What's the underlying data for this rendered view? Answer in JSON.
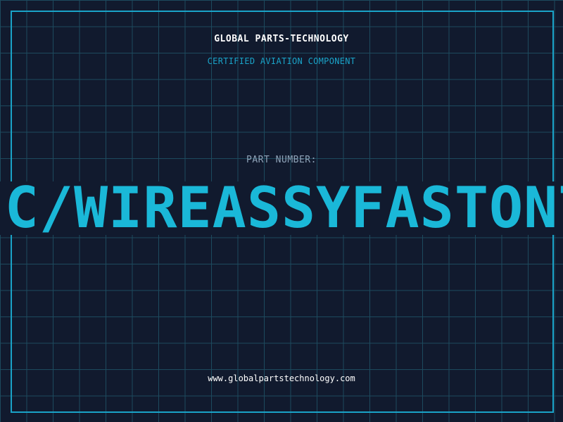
{
  "header": {
    "company": "GLOBAL PARTS-TECHNOLOGY",
    "subtitle": "CERTIFIED AVIATION COMPONENT"
  },
  "part": {
    "label": "PART NUMBER:",
    "value": "-C/WIREASSYFASTONT"
  },
  "footer": {
    "url": "www.globalpartstechnology.com"
  },
  "colors": {
    "background": "#111a2e",
    "grid": "#1d4a5e",
    "accent": "#1aa3c8",
    "part_number": "#1ab8d8",
    "label": "#8fa3b8",
    "text": "#ffffff"
  }
}
